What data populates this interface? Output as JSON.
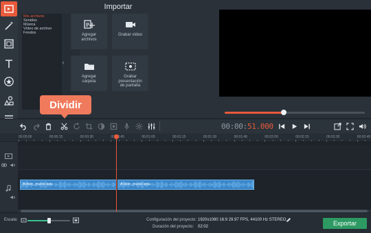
{
  "import": {
    "title": "Importar",
    "categories": [
      "Mis archivos",
      "Sonidos",
      "Música",
      "Vídeo de archivo",
      "Fondos"
    ],
    "tiles": [
      {
        "label": "Agregar\narchivos",
        "icon": "add-files-icon"
      },
      {
        "label": "Grabar vídeo",
        "icon": "video-camera-icon"
      },
      {
        "label": "Agregar\ncarpeta",
        "icon": "folder-icon"
      },
      {
        "label": "Grabar\npresentación\nde pantalla",
        "icon": "screen-record-icon"
      }
    ]
  },
  "tools": [
    "import-icon",
    "magic-wand-icon",
    "filmstrip-icon",
    "title-text-icon",
    "sticker-star-icon",
    "shapes-icon",
    "menu-lines-icon"
  ],
  "tooltip": "Dividir",
  "player": {
    "progress": 0.41,
    "timecode_dim": "00:00:",
    "timecode_highlight": "51.000"
  },
  "ruler": [
    "00:00:00",
    "00:00:15",
    "00:00:30",
    "00:00:45",
    "00:01:00",
    "00:01:15",
    "00:01:30",
    "00:01:45",
    "00:02:00",
    "00:02:15",
    "00:02:30",
    "00:02:45"
  ],
  "clips": [
    {
      "label": "Action_music.wav"
    },
    {
      "label": "Action_music.wav"
    }
  ],
  "bottom": {
    "scale_label": "Escala:",
    "scale_level": 0.5,
    "config_label": "Configuración del proyecto:",
    "config_value": "1920x1080 16:9 29.97 FPS, 44100 Hz STEREO",
    "duration_label": "Duración del proyecto:",
    "duration_value": "02:02",
    "export_label": "Exportar"
  },
  "colors": {
    "accent": "#e85a3b",
    "tooltip": "#f07a5c",
    "clip": "#3b87c9",
    "export": "#2d9a63"
  }
}
